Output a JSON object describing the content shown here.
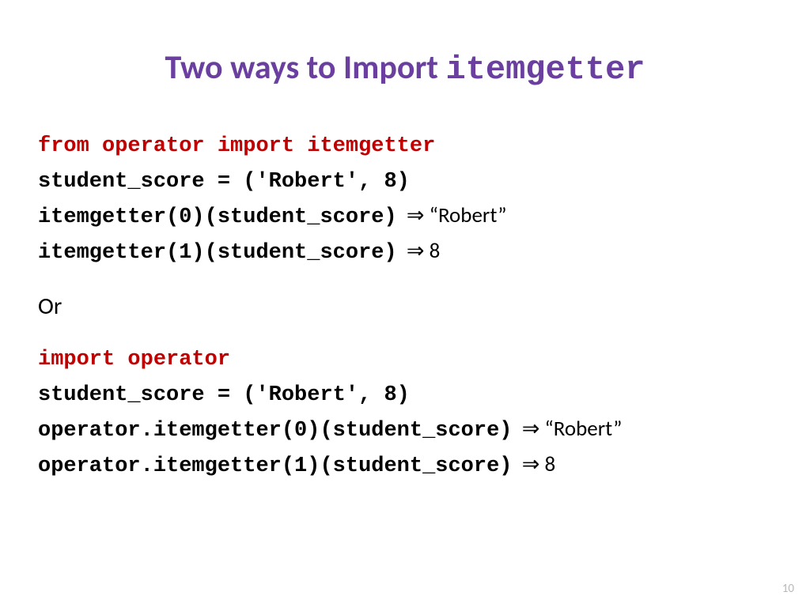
{
  "title": {
    "prefix": "Two ways to Import ",
    "mono": "itemgetter"
  },
  "block1": {
    "import": "from operator import itemgetter",
    "assign": "student_score = ('Robert', 8)",
    "call0": "itemgetter(0)(student_score)",
    "res0": "“Robert”",
    "call1": "itemgetter(1)(student_score)",
    "res1": "8"
  },
  "or_label": "Or",
  "block2": {
    "import": "import operator",
    "assign": "student_score = ('Robert', 8)",
    "call0": "operator.itemgetter(0)(student_score)",
    "res0": "“Robert”",
    "call1": "operator.itemgetter(1)(student_score)",
    "res1": "8"
  },
  "arrow": "⇒",
  "page_number": "10"
}
